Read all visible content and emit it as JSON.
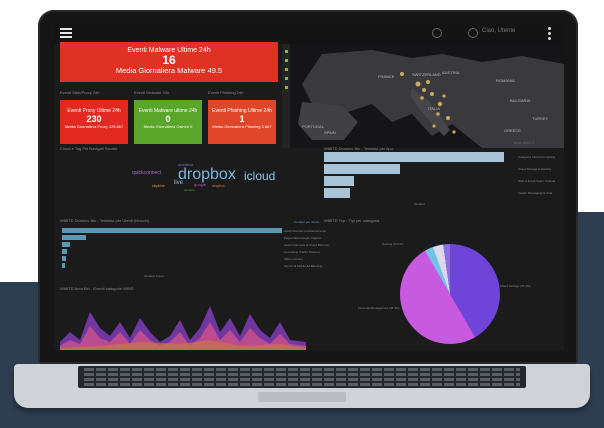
{
  "header": {
    "user_label": "Ciao, Utente"
  },
  "top_kpi": {
    "title": "Eventi Malware Ultime 24h",
    "value": "16",
    "subtitle": "Media Giornaliera Malware 49.5"
  },
  "panel_labels": {
    "proxy": "Eventi Web/Proxy 24h",
    "malware": "Eventi Malware 24h",
    "phishing": "Eventi Phishing 24h",
    "wordcloud": "Cloud e Tag Più Navigati Faudet",
    "topbar_chart": "WMITD Dominio Bin - Tentativi per tipo",
    "midbar_chart": "WMITD Dominio Bin - Tentativi per Utenti (blocchi)",
    "pie_chart": "WMITD Top - Tipi per categoria",
    "area_chart": "WMITD Area Bin - Eventi categorie WINS"
  },
  "kpi_cards": [
    {
      "title": "Eventi Proxy Ultime 24h",
      "value": "230",
      "subtitle": "Media Giornaliera Proxy 225.667"
    },
    {
      "title": "Eventi Malware ultime 24h",
      "value": "0",
      "subtitle": "Media Giornaliera Ostrich 0"
    },
    {
      "title": "Eventi Phishing Ultime 24h",
      "value": "1",
      "subtitle": "Media Giornaliera Phishing 3.667"
    }
  ],
  "map": {
    "countries": [
      "FRANCE",
      "SWITZERLAND",
      "AUSTRIA",
      "ITALIA",
      "ROMANIA",
      "PORTUGAL",
      "SPAIN",
      "BULGARIA",
      "TURKEY",
      "GREECE"
    ],
    "attribution": "Map data ©"
  },
  "wordcloud": {
    "words": [
      "dropbox",
      "icloud",
      "quickconnect",
      "onedrive",
      "live",
      "google",
      "dropbox",
      "skydrive",
      "amazon"
    ]
  },
  "top_bar_chart": {
    "labels": [
      "Categoria Cloud Computing",
      "Cloud Storage & Hosting",
      "Web & Email Spam Outlook",
      "Instant Messaging & Chat"
    ],
    "axis": "Tentativi"
  },
  "mid_bar_chart": {
    "legend": "Tentativi per utente",
    "labels": [
      "Utenti bloccati quotidianamente",
      "Pages Web Google Tagless",
      "Utenti Connessi al Cloud Bloccati",
      "Consulting Traffic/ Sistema",
      "Video Content",
      "Servizi di Mobile Ad Blocking"
    ],
    "axis": "Tentativi Count"
  },
  "pie_chart": {
    "labels": [
      "Hosting (8.27%)",
      "Cloud Storage (75.3%)",
      "Personal Management (38.3%)"
    ]
  },
  "colors": {
    "red": "#e03224",
    "green": "#5aa62a",
    "orange": "#e0462a",
    "pie_purple": "#6e45d8",
    "pie_magenta": "#c85ae0",
    "bar_blue": "#a8c4d6"
  }
}
